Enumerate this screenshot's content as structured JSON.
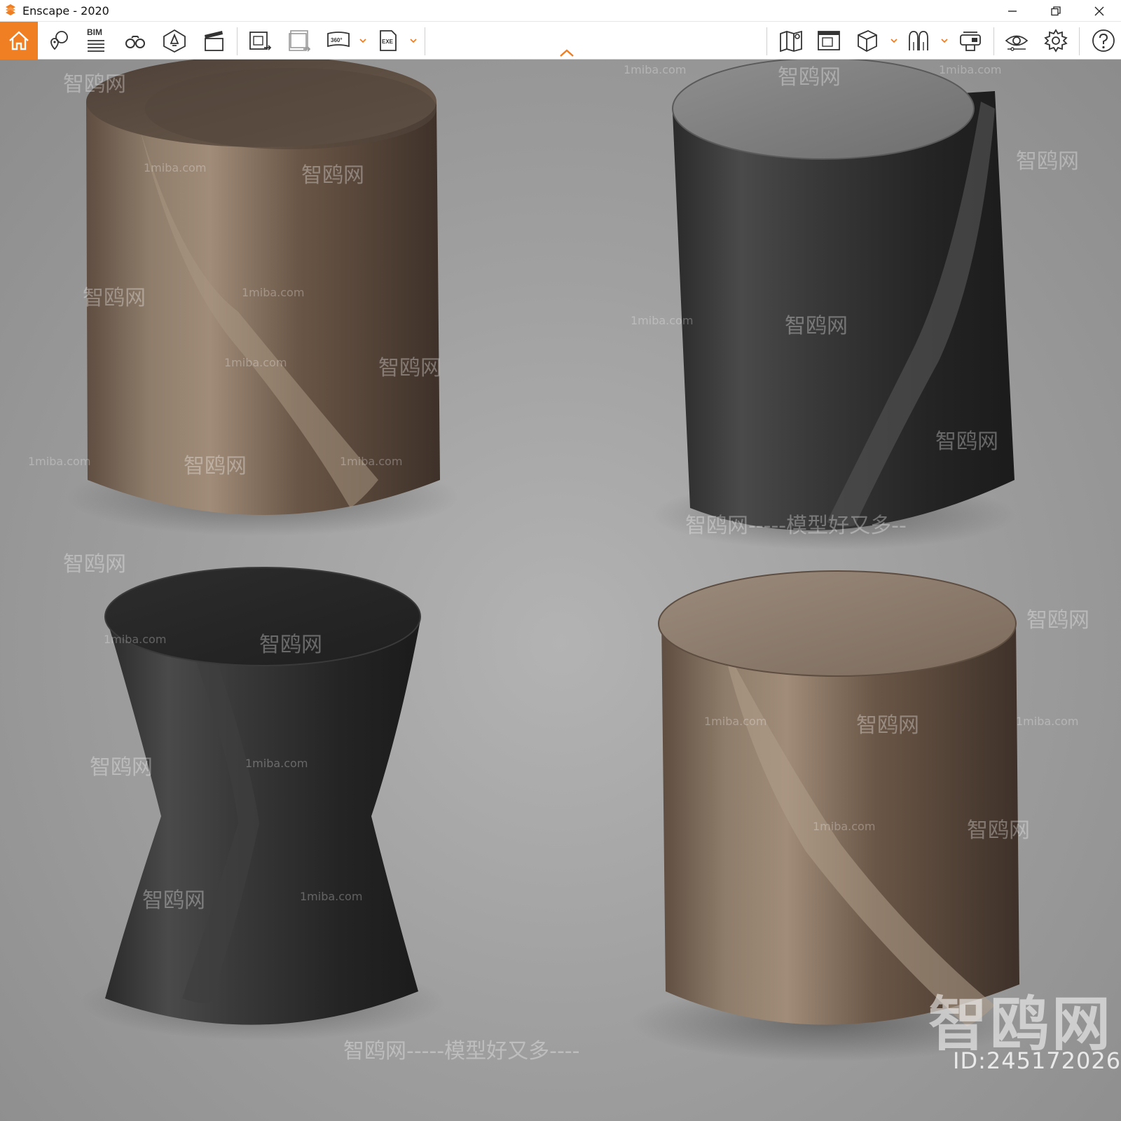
{
  "window": {
    "title": "Enscape - 2020"
  },
  "toolbar": {
    "bim_label": "BIM",
    "icons": [
      "home-icon",
      "asset-library-icon",
      "bim-icon",
      "binoculars-icon",
      "artificial-light-icon",
      "video-editor-icon",
      "batch-render-icon",
      "export-batch-icon",
      "panorama-360-icon",
      "exe-export-icon",
      "map-icon",
      "rendering-pane-icon",
      "view-cube-icon",
      "material-editor-icon",
      "vr-headset-icon",
      "visual-settings-icon",
      "general-settings-icon",
      "help-icon"
    ],
    "panorama_label": "360°",
    "exe_label": "EXE",
    "accent_color": "#f07f23"
  },
  "watermarks": {
    "site_cn": "智鸥网",
    "site_en": "1miba.com",
    "slogan": "智鸥网-----模型好又多----",
    "slogan_right": "智鸥网-----模型好又多--",
    "big_logo": "智鸥网",
    "id_text": "ID:245172026"
  },
  "scene": {
    "objects": [
      "bronze-cylinder-stool",
      "black-cylinder-stool",
      "black-hourglass-stool",
      "bronze-cylinder-stool-front"
    ],
    "colors": {
      "floor": "#a5a5a5",
      "bronze": "#6b5a4c",
      "black": "#2c2c2c"
    }
  }
}
